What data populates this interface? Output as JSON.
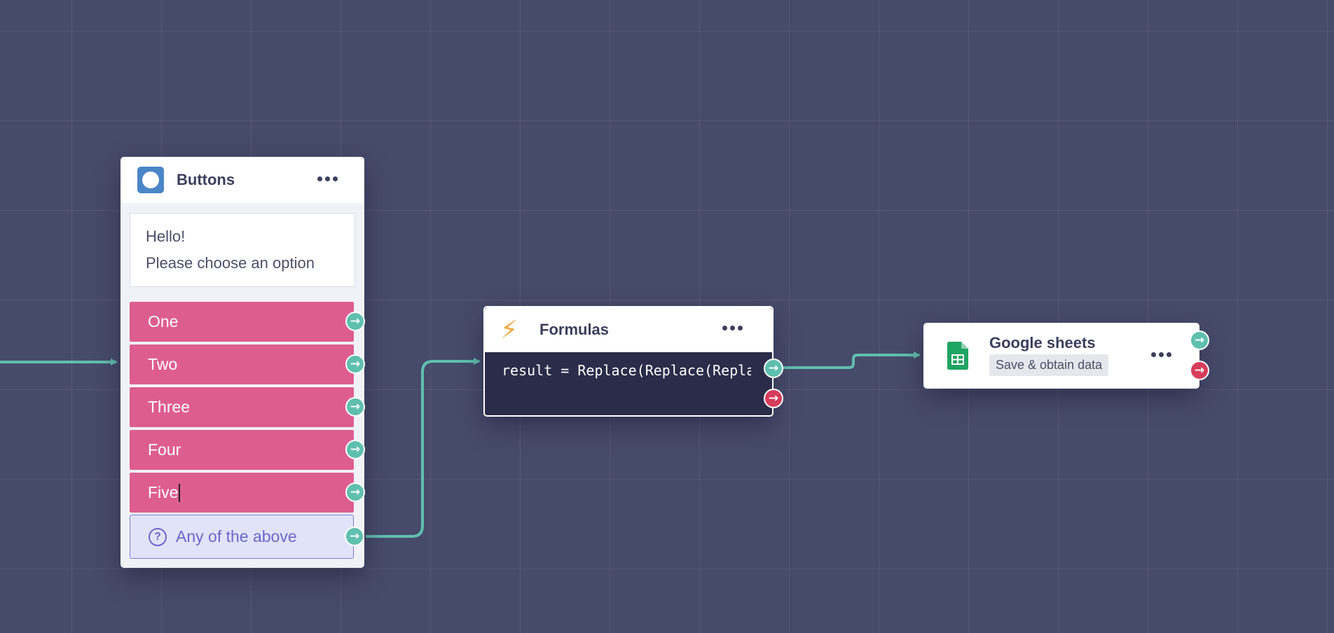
{
  "canvas": {
    "background_color": "#474b6b",
    "connection_color": "#5fbfae"
  },
  "nodes": {
    "buttons": {
      "title": "Buttons",
      "icon": "circle-app-icon",
      "message_lines": [
        "Hello!",
        "Please choose an option"
      ],
      "choices": [
        "One",
        "Two",
        "Three",
        "Four",
        "Five"
      ],
      "fallback": {
        "label": "Any of the above",
        "icon": "question-circle-icon"
      },
      "choice_color": "#de5d91"
    },
    "formulas": {
      "title": "Formulas",
      "icon": "lightning-bolt-icon",
      "code": "result = Replace(Replace(Replace("
    },
    "sheets": {
      "title": "Google sheets",
      "icon": "google-sheets-icon",
      "badge": "Save & obtain data"
    }
  },
  "ports": {
    "success_color": "#5fbfae",
    "error_color": "#d63c5c",
    "arrow_glyph": "→"
  }
}
